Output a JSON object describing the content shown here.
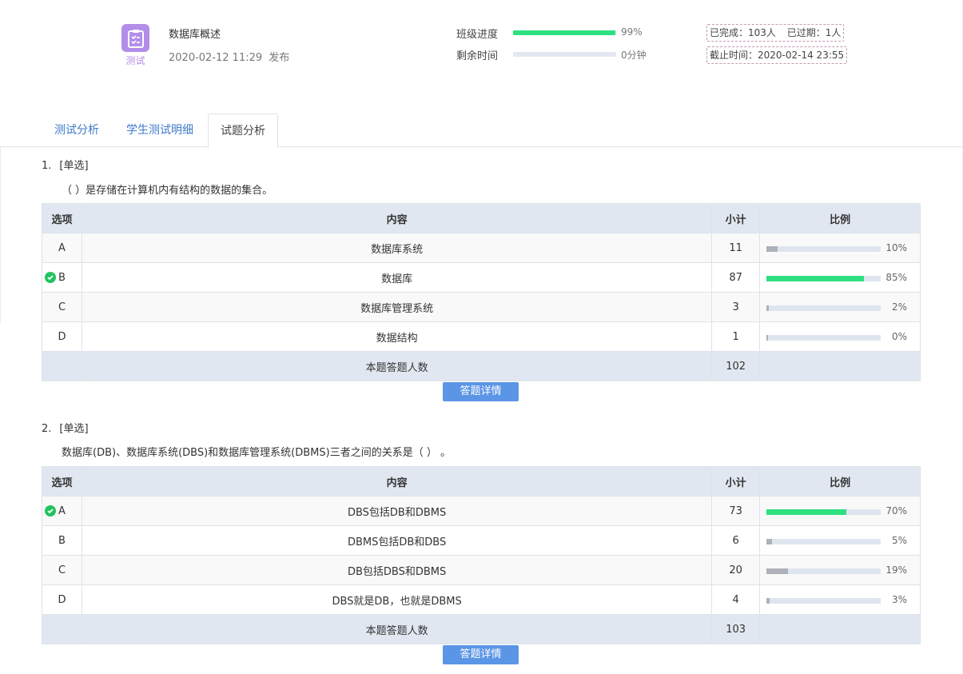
{
  "header": {
    "icon_label": "测试",
    "title": "数据库概述",
    "publish_time": "2020-02-12 11:29",
    "publish_suffix": "发布",
    "class_progress_label": "班级进度",
    "class_progress_value": "99%",
    "class_progress_fraction": 0.99,
    "remaining_label": "剩余时间",
    "remaining_value": "0分钟",
    "remaining_fraction": 0,
    "completed_text": "已完成：103人",
    "overdue_text": "已过期：1人",
    "deadline_text": "截止时间：2020-02-14 23:55"
  },
  "tabs": [
    {
      "label": "测试分析",
      "active": false
    },
    {
      "label": "学生测试明细",
      "active": false
    },
    {
      "label": "试题分析",
      "active": true
    }
  ],
  "table_headers": {
    "option": "选项",
    "content": "内容",
    "count": "小计",
    "ratio": "比例"
  },
  "questions": [
    {
      "number": "1.",
      "type": "[单选]",
      "stem": "（ ）是存储在计算机内有结构的数据的集合。",
      "options": [
        {
          "letter": "A",
          "content": "数据库系统",
          "count": "11",
          "ratio": "10%",
          "fraction": 0.1,
          "correct": false
        },
        {
          "letter": "B",
          "content": "数据库",
          "count": "87",
          "ratio": "85%",
          "fraction": 0.85,
          "correct": true
        },
        {
          "letter": "C",
          "content": "数据库管理系统",
          "count": "3",
          "ratio": "2%",
          "fraction": 0.02,
          "correct": false
        },
        {
          "letter": "D",
          "content": "数据结构",
          "count": "1",
          "ratio": "0%",
          "fraction": 0.0,
          "correct": false
        }
      ],
      "total_label": "本题答题人数",
      "total": "102",
      "detail_button": "答题详情"
    },
    {
      "number": "2.",
      "type": "[单选]",
      "stem": "数据库(DB)、数据库系统(DBS)和数据库管理系统(DBMS)三者之间的关系是（ ） 。",
      "options": [
        {
          "letter": "A",
          "content": "DBS包括DB和DBMS",
          "count": "73",
          "ratio": "70%",
          "fraction": 0.7,
          "correct": true
        },
        {
          "letter": "B",
          "content": "DBMS包括DB和DBS",
          "count": "6",
          "ratio": "5%",
          "fraction": 0.05,
          "correct": false
        },
        {
          "letter": "C",
          "content": "DB包括DBS和DBMS",
          "count": "20",
          "ratio": "19%",
          "fraction": 0.19,
          "correct": false
        },
        {
          "letter": "D",
          "content": "DBS就是DB，也就是DBMS",
          "count": "4",
          "ratio": "3%",
          "fraction": 0.03,
          "correct": false
        }
      ],
      "total_label": "本题答题人数",
      "total": "103",
      "detail_button": "答题详情"
    }
  ],
  "colors": {
    "accent_blue": "#5b95e6",
    "progress_green": "#2ee07f",
    "icon_purple": "#b38ee9",
    "correct_green": "#22c35e"
  }
}
